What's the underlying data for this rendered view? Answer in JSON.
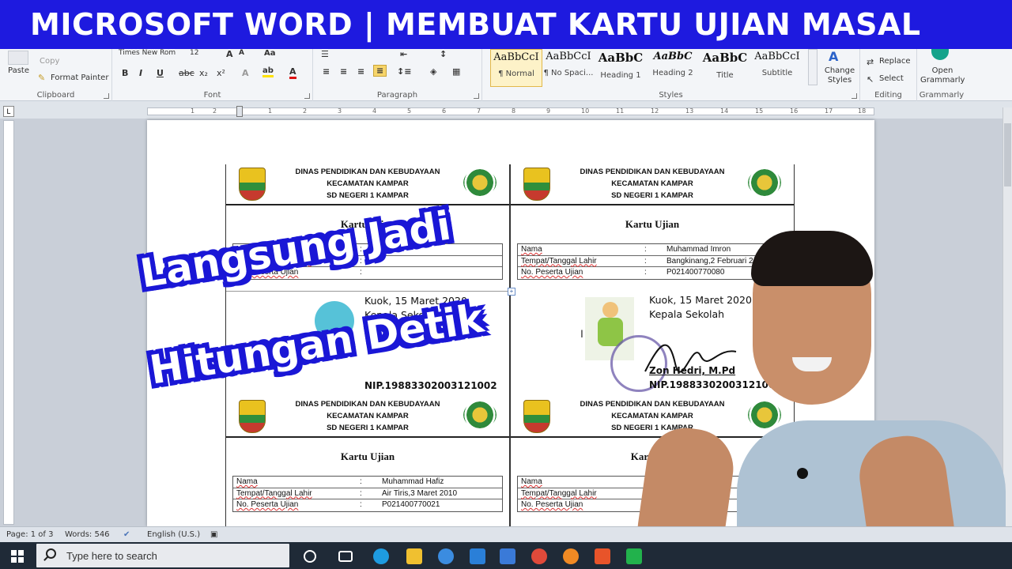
{
  "banner": {
    "title": "MICROSOFT WORD | MEMBUAT KARTU UJIAN MASAL"
  },
  "ribbon": {
    "clipboard": {
      "paste": "Paste",
      "copy": "Copy",
      "format_painter": "Format Painter",
      "label": "Clipboard"
    },
    "font": {
      "name": "Times New Rom",
      "size": "12",
      "label": "Font",
      "bold": "B",
      "italic": "I",
      "underline": "U",
      "strike": "abc",
      "sub": "x₂",
      "sup": "x²"
    },
    "paragraph": {
      "label": "Paragraph"
    },
    "styles": {
      "label": "Styles",
      "items": [
        {
          "sample": "AaBbCcI",
          "name": "¶ Normal"
        },
        {
          "sample": "AaBbCcI",
          "name": "¶ No Spaci..."
        },
        {
          "sample": "AaBbC",
          "name": "Heading 1"
        },
        {
          "sample": "AaBbC",
          "name": "Heading 2"
        },
        {
          "sample": "AaBbC",
          "name": "Title"
        },
        {
          "sample": "AaBbCcI",
          "name": "Subtitle"
        }
      ],
      "change_styles": "Change Styles"
    },
    "editing": {
      "replace": "Replace",
      "select": "Select",
      "label": "Editing"
    },
    "grammarly": {
      "open": "Open Grammarly",
      "label": "Grammarly"
    }
  },
  "ruler": {
    "numbers": [
      "1",
      "2",
      "1",
      "2",
      "3",
      "4",
      "5",
      "6",
      "7",
      "8",
      "9",
      "10",
      "11",
      "12",
      "13",
      "14",
      "15",
      "16",
      "17",
      "18"
    ]
  },
  "cards": [
    {
      "header": [
        "DINAS PENDIDIKAN DAN KEBUDAYAAN",
        "KECAMATAN KAMPAR",
        "SD NEGERI 1 KAMPAR"
      ],
      "title": "Kartu Ujian",
      "rows": [
        {
          "label": "Nama",
          "colon": ":",
          "value": ""
        },
        {
          "label": "Tempat/Tanggal Lahir",
          "colon": ":",
          "value": ""
        },
        {
          "label": "No. Peserta Ujian",
          "colon": ":",
          "value": ""
        }
      ],
      "sign": {
        "date": "Kuok, 15 Maret 2020",
        "role": "Kepala Sekolah",
        "name": "",
        "nip": "NIP.19883302003121002"
      }
    },
    {
      "header": [
        "DINAS PENDIDIKAN DAN KEBUDAYAAN",
        "KECAMATAN KAMPAR",
        "SD NEGERI 1 KAMPAR"
      ],
      "title": "Kartu Ujian",
      "rows": [
        {
          "label": "Nama",
          "colon": ":",
          "value": "Muhammad Imron"
        },
        {
          "label": "Tempat/Tanggal Lahir",
          "colon": ":",
          "value": "Bangkinang,2 Februari 2"
        },
        {
          "label": "No. Peserta Ujian",
          "colon": ":",
          "value": "P021400770080"
        }
      ],
      "sign": {
        "date": "Kuok, 15 Maret 2020",
        "role": "Kepala Sekolah",
        "name": "Zon Hedri, M.Pd",
        "nip": "NIP.19883302003121002"
      }
    },
    {
      "header": [
        "DINAS PENDIDIKAN DAN KEBUDAYAAN",
        "KECAMATAN KAMPAR",
        "SD NEGERI 1 KAMPAR"
      ],
      "title": "Kartu Ujian",
      "rows": [
        {
          "label": "Nama",
          "colon": ":",
          "value": "Muhammad Hafiz"
        },
        {
          "label": "Tempat/Tanggal Lahir",
          "colon": ":",
          "value": "Air Tiris,3 Maret 2010"
        },
        {
          "label": "No. Peserta Ujian",
          "colon": ":",
          "value": "P021400770021"
        }
      ]
    },
    {
      "header": [
        "DINAS PENDIDIKAN DAN KEBUDAYAAN",
        "KECAMATAN KAMPAR",
        "SD NEGERI 1 KAMPAR"
      ],
      "title": "Kartu Uji",
      "rows": [
        {
          "label": "Nama",
          "colon": ":",
          "value": ""
        },
        {
          "label": "Tempat/Tanggal Lahir",
          "colon": ":",
          "value": ""
        },
        {
          "label": "No. Peserta Ujian",
          "colon": ":",
          "value": ""
        }
      ]
    }
  ],
  "overlay": {
    "line1": "Langsung Jadi",
    "line2": "Hitungan Detik"
  },
  "status": {
    "page": "Page: 1 of 3",
    "words": "Words: 546",
    "lang": "English (U.S.)"
  },
  "taskbar": {
    "search_placeholder": "Type here to search"
  },
  "colors": {
    "banner": "#1e1adf",
    "overlay_outline": "#1a17d6",
    "taskbar": "#1f2a37"
  }
}
